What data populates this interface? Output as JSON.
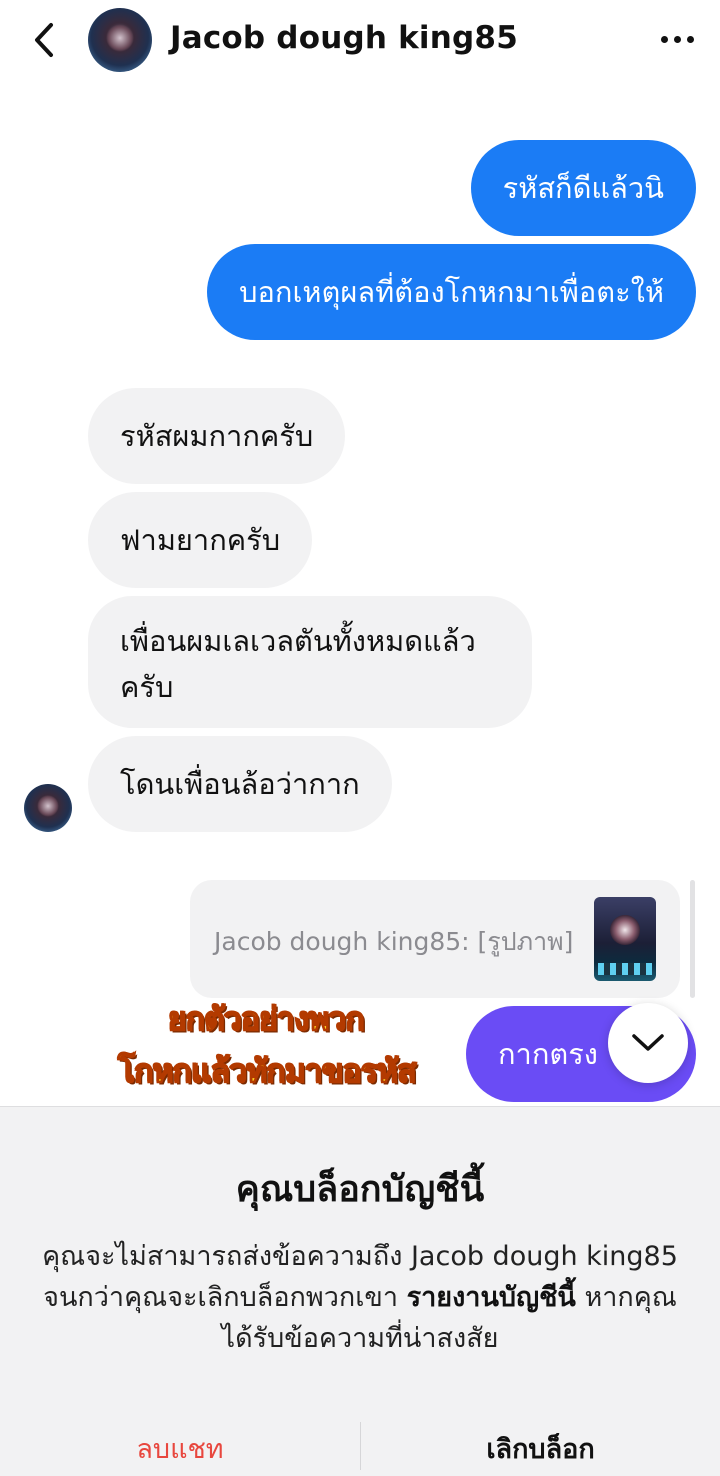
{
  "header": {
    "title": "Jacob dough king85",
    "back_icon": "chevron-left-icon",
    "more_icon": "more-horizontal-icon"
  },
  "messages": [
    {
      "side": "sent",
      "text": "รหัสก็ดีแล้วนิ"
    },
    {
      "side": "sent",
      "text": "บอกเหตุผลที่ต้องโกหกมาเพื่อตะให้"
    },
    {
      "side": "received",
      "text": "รหัสผมกากครับ"
    },
    {
      "side": "received",
      "text": "ฟามยากครับ"
    },
    {
      "side": "received",
      "text": "เพื่อนผมเลเวลตันทั้งหมดแล้วครับ"
    },
    {
      "side": "received",
      "text": "โดนเพื่อนล้อว่ากาก"
    }
  ],
  "reply_preview": {
    "text": "Jacob dough king85: [รูปภาพ]"
  },
  "partial_message": {
    "text": "กากตรง"
  },
  "overlay_caption": {
    "line1": "ยกตัวอย่างพวก",
    "line2": "โกหกแล้วทักมาขอรหัส"
  },
  "block_sheet": {
    "title": "คุณบล็อกบัญชีนี้",
    "body_part1": "คุณจะไม่สามารถส่งข้อความถึง Jacob dough king85 จนกว่าคุณจะเลิกบล็อกพวกเขา ",
    "body_link": "รายงานบัญชีนี้",
    "body_part2": " หากคุณได้รับข้อความที่น่าสงสัย",
    "delete_label": "ลบแชท",
    "unblock_label": "เลิกบล็อก"
  },
  "colors": {
    "sent_bubble": "#1b7cf5",
    "received_bubble": "#f2f2f3",
    "purple_bubble": "#6a4cf5",
    "delete_red": "#e8473e",
    "caption_yellow": "#ffd21f"
  }
}
